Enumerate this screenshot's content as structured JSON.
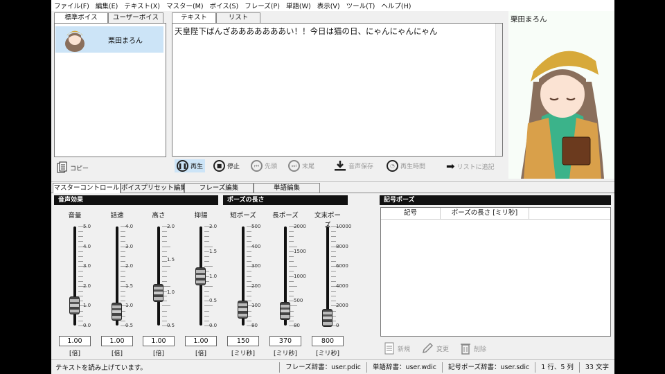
{
  "menu": [
    "ファイル(F)",
    "編集(E)",
    "テキスト(X)",
    "マスター(M)",
    "ボイス(S)",
    "フレーズ(P)",
    "単語(W)",
    "表示(V)",
    "ツール(T)",
    "ヘルプ(H)"
  ],
  "voice_tabs": [
    "標準ボイス",
    "ユーザーボイス"
  ],
  "voice_list": [
    {
      "name": "栗田まろん",
      "selected": true
    }
  ],
  "copy_label": "コピー",
  "editor_tabs": [
    "テキスト",
    "リスト"
  ],
  "editor_text": "天皇陛下ばんざあああああああい！！今日は猫の日、にゃんにゃんにゃん",
  "toolbar": {
    "play": "再生",
    "stop": "停止",
    "head": "先頭",
    "tail": "末尾",
    "save": "音声保存",
    "time": "再生時間",
    "add": "リストに追記"
  },
  "character_name": "栗田まろん",
  "bottom_tabs": [
    "マスターコントロール",
    "ボイスプリセット編集",
    "フレーズ編集",
    "単語編集"
  ],
  "sections": {
    "effect": "音声効果",
    "pause": "ポーズの長さ",
    "symbol": "記号ポーズ"
  },
  "sliders": [
    {
      "label": "音量",
      "value": "1.00",
      "unit": "[倍]",
      "ticks": [
        "5.0",
        "4.0",
        "3.0",
        "2.0",
        "1.0",
        "0.0"
      ],
      "level": 0.2
    },
    {
      "label": "話速",
      "value": "1.00",
      "unit": "[倍]",
      "ticks": [
        "4.0",
        "3.0",
        "2.0",
        "1.5",
        "1.0",
        "0.5"
      ],
      "level": 0.14
    },
    {
      "label": "高さ",
      "value": "1.00",
      "unit": "[倍]",
      "ticks": [
        "2.0",
        "1.5",
        "1.0",
        "0.5"
      ],
      "level": 0.33
    },
    {
      "label": "抑揚",
      "value": "1.00",
      "unit": "[倍]",
      "ticks": [
        "2.0",
        "1.5",
        "1.0",
        "0.5",
        "0.0"
      ],
      "level": 0.5
    },
    {
      "label": "短ポーズ",
      "value": "150",
      "unit": "[ミリ秒]",
      "ticks": [
        "500",
        "400",
        "300",
        "200",
        "100",
        "80"
      ],
      "level": 0.16
    },
    {
      "label": "長ポーズ",
      "value": "370",
      "unit": "[ミリ秒]",
      "ticks": [
        "2000",
        "1500",
        "1000",
        "500",
        "80"
      ],
      "level": 0.15
    },
    {
      "label": "文末ポーズ",
      "value": "800",
      "unit": "[ミリ秒]",
      "ticks": [
        "10000",
        "8000",
        "6000",
        "4000",
        "2000",
        "0"
      ],
      "level": 0.08
    }
  ],
  "symbol_table": {
    "headers": [
      "記号",
      "ポーズの長さ [ミリ秒]"
    ]
  },
  "symbol_actions": {
    "new": "新規",
    "edit": "変更",
    "delete": "削除"
  },
  "status": {
    "message": "テキストを読み上げています。",
    "phrase_dict": "フレーズ辞書：user.pdic",
    "word_dict": "単語辞書：user.wdic",
    "symbol_dict": "記号ポーズ辞書：user.sdic",
    "position": "1 行、5 列",
    "count": "33 文字"
  },
  "colors": {
    "selection": "#cce4f7",
    "section_header": "#111111",
    "char_bg": "#f8fdf8"
  }
}
